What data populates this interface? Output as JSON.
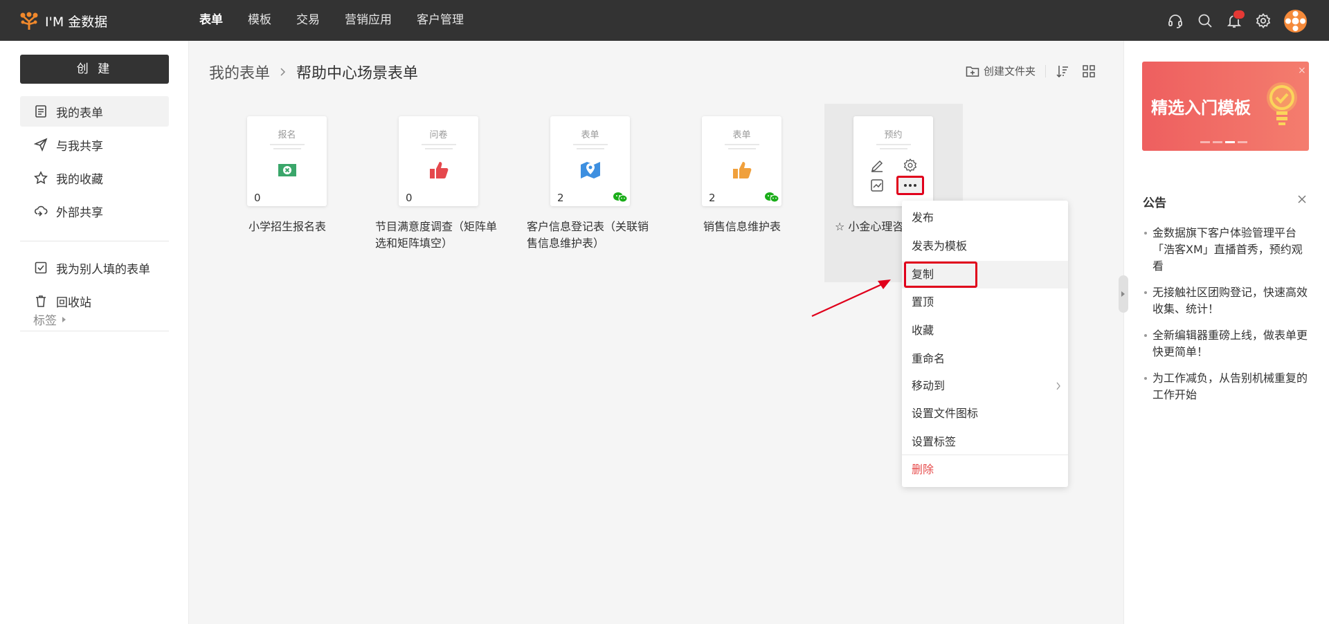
{
  "brand": {
    "name": "I'M 金数据",
    "color": "#f0882b"
  },
  "nav": [
    {
      "label": "表单",
      "active": true
    },
    {
      "label": "模板"
    },
    {
      "label": "交易"
    },
    {
      "label": "营销应用"
    },
    {
      "label": "客户管理"
    }
  ],
  "topbar_icons": [
    "headset-icon",
    "search-icon",
    "bell-icon",
    "gear-icon"
  ],
  "sidebar": {
    "create_label": "创 建",
    "items": [
      {
        "label": "我的表单",
        "icon": "form-icon",
        "active": true
      },
      {
        "label": "与我共享",
        "icon": "paper-plane-icon"
      },
      {
        "label": "我的收藏",
        "icon": "star-icon"
      },
      {
        "label": "外部共享",
        "icon": "cloud-share-icon"
      },
      {
        "label": "我为别人填的表单",
        "icon": "checkbox-icon"
      },
      {
        "label": "回收站",
        "icon": "trash-icon"
      }
    ],
    "tags_label": "标签"
  },
  "breadcrumb": {
    "root": "我的表单",
    "current": "帮助中心场景表单"
  },
  "toolbar": {
    "create_folder": "创建文件夹"
  },
  "forms": [
    {
      "type": "报名",
      "count": "0",
      "title": "小学招生报名表",
      "icon": "enroll-icon",
      "icon_color": "#3aa66a"
    },
    {
      "type": "问卷",
      "count": "0",
      "title": "节目满意度调查（矩阵单选和矩阵填空）",
      "icon": "thumbs-up-icon",
      "icon_color": "#e5484d"
    },
    {
      "type": "表单",
      "count": "2",
      "title": "客户信息登记表（关联销售信息维护表）",
      "icon": "map-pin-icon",
      "icon_color": "#3d8fe0",
      "wechat": true
    },
    {
      "type": "表单",
      "count": "2",
      "title": "销售信息维护表",
      "icon": "thumbs-up-icon",
      "icon_color": "#f0a03c",
      "wechat": true
    },
    {
      "type": "预约",
      "title": "☆ 小金心理咨",
      "hovered": true
    }
  ],
  "context_menu": {
    "items": [
      {
        "label": "发布"
      },
      {
        "label": "发表为模板"
      },
      {
        "label": "复制",
        "highlighted": true
      },
      {
        "label": "置顶"
      },
      {
        "label": "收藏"
      },
      {
        "label": "重命名"
      },
      {
        "label": "移动到",
        "submenu": true
      },
      {
        "label": "设置文件图标"
      },
      {
        "label": "设置标签"
      },
      {
        "label": "删除",
        "danger": true
      }
    ]
  },
  "banner": {
    "text": "精选入门模板",
    "close": "×"
  },
  "notice": {
    "title": "公告",
    "items": [
      "金数据旗下客户体验管理平台「浩客XM」直播首秀，预约观看",
      "无接触社区团购登记，快速高效收集、统计！",
      "全新编辑器重磅上线，做表单更快更简单！",
      "为工作减负，从告别机械重复的工作开始"
    ]
  },
  "colors": {
    "topbar": "#333333",
    "annotation": "#e0001b",
    "danger": "#e64b4b"
  }
}
